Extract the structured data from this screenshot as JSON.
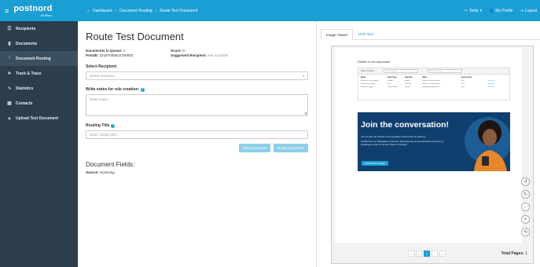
{
  "brand": {
    "name": "postnord",
    "sub": "Strålfors"
  },
  "breadcrumbs": [
    "Dashboard",
    "Document Routing",
    "Route Test Document"
  ],
  "topbar": {
    "tools": "Tools",
    "profile": "My Profile",
    "logout": "Logout"
  },
  "sidebar": {
    "items": [
      {
        "label": "Recipients",
        "icon": "list-icon"
      },
      {
        "label": "Documents",
        "icon": "file-icon"
      },
      {
        "label": "Document Routing",
        "icon": "chart-icon"
      },
      {
        "label": "Track & Trace",
        "icon": "send-icon"
      },
      {
        "label": "Statistics",
        "icon": "stats-icon"
      },
      {
        "label": "Contacts",
        "icon": "contact-icon"
      },
      {
        "label": "Upload Test Document",
        "icon": "upload-icon"
      }
    ],
    "active_index": 2
  },
  "main": {
    "title": "Route Test Document",
    "documents_in_queue_label": "Documents in Queue:",
    "documents_in_queue_value": "1",
    "score_label": "Score:",
    "score_value": "0",
    "preid_label": "PreUID:",
    "preid_value": "22187005622700002",
    "suggested_label": "Suggested Recipient:",
    "suggested_value": "Not available",
    "select_recipient_label": "Select Recipient:",
    "select_recipient_placeholder": "Select recipient...",
    "notes_label": "Write notes for rule creation:",
    "notes_placeholder": "Enter notes...",
    "routing_title_label": "Routing Title",
    "routing_title_placeholder": "Enter routing title...",
    "skip_button": "Skip Document",
    "route_button": "Route Document",
    "fields_title": "Document Fields:",
    "source_label": "Source:",
    "source_value": "Scanning"
  },
  "viewer": {
    "tab_image": "Image Viewer",
    "tab_ocr": "OCR Text",
    "doc_title": "Delete or set document",
    "inner_bar_label": "Rules in library",
    "inner_search_1": "Search by name",
    "inner_search_2": "Search by value",
    "inner_headers": [
      "Name",
      "Field Type",
      "Operator",
      "Value",
      "Ignore Case",
      ""
    ],
    "inner_rows": [
      [
        "Delete or set (to page)",
        "Subject",
        "equals",
        "Delete or set document",
        "Yes",
        "Remove"
      ],
      [
        "Delete or set page",
        "text",
        "contains",
        "Delete or set document",
        "Yes",
        "Remove"
      ],
      [
        "Delete this page",
        "sender Email",
        "equals",
        "noreply@stralfors.com",
        "Yes",
        "Remove"
      ]
    ],
    "banner_title": "Join the conversation!",
    "banner_text_1": "Vem du glöm att Smarter Communication Summit den 15 oktober?",
    "banner_text_2": "Individuell on nu tillgängligt on demand. Alla inspelning af spænderande keynotes og fordelingene inden for temat \"Power to Change\".",
    "banner_button": "Individuell här ideagein",
    "pager": {
      "current": "1"
    },
    "total_label": "Total Pages:",
    "total_value": "1"
  },
  "colors": {
    "accent": "#1a9fd4",
    "sidebar": "#2c3e4c",
    "banner": "#0f3f6e"
  }
}
